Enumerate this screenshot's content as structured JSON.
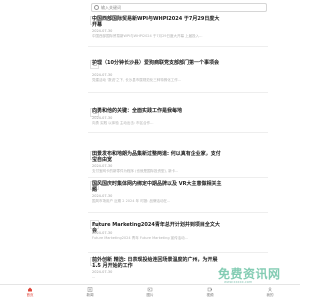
{
  "search": {
    "placeholder": "输入关键词"
  },
  "articles": [
    {
      "title": "中国西部国际贸易新WPI与WHPI2024 于7月29日度大开幕",
      "date": "2024-07-30",
      "summary": "中国西部国际贸易新WPI与WHPI2024 于7月29日度大开幕 上届投入..."
    },
    {
      "title": "护理（10分钟长沙县）爱狗病联党支部部门第一个事项会",
      "date": "2024-07-30",
      "summary": "党建活动 '数说'之下, 长沙县市属规范化三种特殊化工作..."
    },
    {
      "title": "向勇和他的关键：全面实践工作是我每地",
      "date": "2024-07-30",
      "summary": "向勇 实践 以体验 主动出击: 市区合作..."
    },
    {
      "title": "田景发布和地朗为品集新过整两道: 何以真有企业家，支付宝自由宽",
      "date": "2024-07-30",
      "summary": "支付宝网卡的新零件为程序 (也就是国际投资型), 新卡..."
    },
    {
      "title": "国风国庆时集体网内绑定中期品牌以及 VR大主意做相关主题",
      "date": "2024-07-30",
      "summary": "国风市场用户 近期 2 2024 年 时报: 品牌活动在..."
    },
    {
      "title": "Future Marketing2024青年总开计划并到项目全文大会",
      "date": "2024-07-30",
      "summary": "Future Marketing2024 青年 Future Marketing 宣传活动..."
    },
    {
      "title": "前外创新 精选: 日表现投给连回场景温度的广州，为开展 1.5 月开始的工作",
      "date": "2024-07-30",
      "summary": "..."
    }
  ],
  "tabs": [
    {
      "label": "首页",
      "icon": "home-icon"
    },
    {
      "label": "新闻",
      "icon": "news-icon"
    },
    {
      "label": "图片",
      "icon": "image-icon"
    },
    {
      "label": "视频",
      "icon": "video-icon"
    },
    {
      "label": "我的",
      "icon": "user-icon"
    }
  ],
  "watermark": {
    "text": "免费资讯网",
    "sub": "www.xxxxx.com"
  },
  "colors": {
    "accent": "#e0453a",
    "watermark": "#6ec4a6"
  }
}
